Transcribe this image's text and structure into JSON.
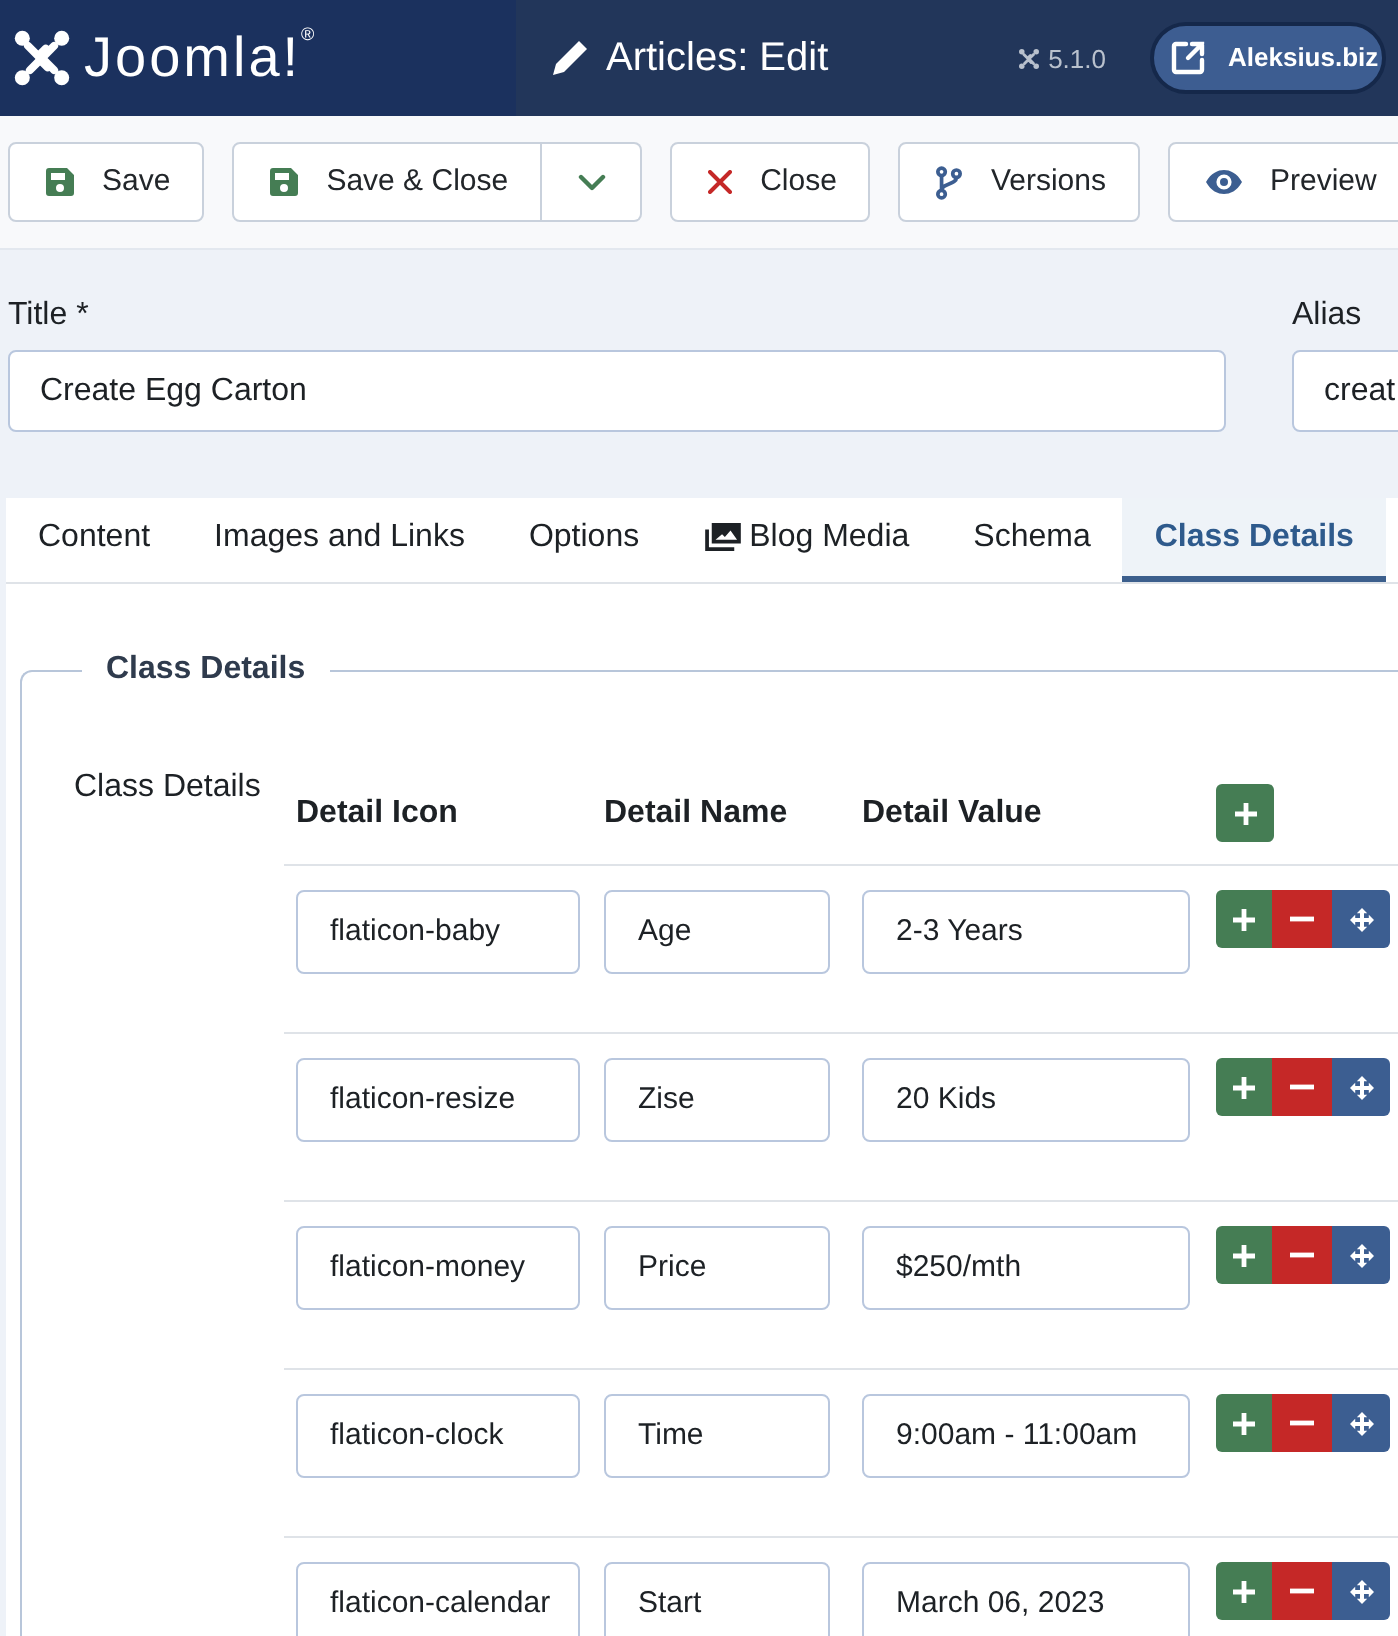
{
  "header": {
    "logo_text": "Joomla!$^{®}$",
    "title": "Articles: Edit",
    "version": "5.1.0",
    "site_link": "Aleksius.biz"
  },
  "toolbar": [
    {
      "kind": "save",
      "label": "Save",
      "dropdown": false
    },
    {
      "kind": "save_close",
      "label": "Save & Close",
      "dropdown": true
    },
    {
      "kind": "close",
      "label": "Close",
      "dropdown": false
    },
    {
      "kind": "versions",
      "label": "Versions",
      "dropdown": false
    },
    {
      "kind": "preview",
      "label": "Preview",
      "dropdown": false
    }
  ],
  "title_field": {
    "label": "Title *",
    "value": "Create Egg Carton"
  },
  "alias_field": {
    "label": "Alias",
    "value": "creat"
  },
  "tabs": [
    {
      "label": "Content",
      "kind": "text",
      "selected": false
    },
    {
      "label": "Images and Links",
      "kind": "text",
      "selected": false
    },
    {
      "label": "Options",
      "kind": "text",
      "selected": false
    },
    {
      "label": "Blog Media",
      "kind": "media",
      "selected": false
    },
    {
      "label": "Schema",
      "kind": "text",
      "selected": false
    },
    {
      "label": "Class Details",
      "kind": "text",
      "selected": true
    }
  ],
  "class_details": {
    "legend": "Class Details",
    "label": "Class Details",
    "columns": [
      "Detail Icon",
      "Detail Name",
      "Detail Value"
    ],
    "rows": [
      {
        "icon_class": "flaticon-baby",
        "name": "Age",
        "value": "2-3 Years"
      },
      {
        "icon_class": "flaticon-resize",
        "name": "Zise",
        "value": "20 Kids"
      },
      {
        "icon_class": "flaticon-money",
        "name": "Price",
        "value": "$250/mth"
      },
      {
        "icon_class": "flaticon-clock",
        "name": "Time",
        "value": "9:00am - 11:00am"
      },
      {
        "icon_class": "flaticon-calendar",
        "name": "Start",
        "value": "March 06, 2023"
      }
    ]
  }
}
